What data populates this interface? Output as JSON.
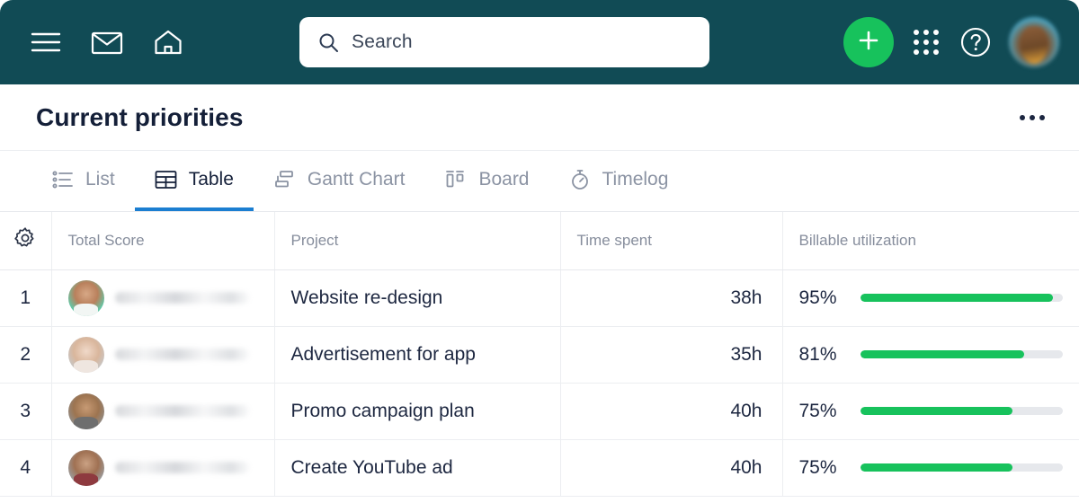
{
  "topbar": {
    "bg_color": "#114b55",
    "icons": [
      {
        "name": "hamburger-menu-icon",
        "label": "Menu"
      },
      {
        "name": "mail-icon",
        "label": "Mail"
      },
      {
        "name": "home-icon",
        "label": "Home"
      }
    ],
    "search": {
      "placeholder": "Search",
      "icon": "search-icon"
    },
    "add_button": {
      "label": "+",
      "color": "#17c25c",
      "icon": "plus-icon"
    },
    "apps_icon": "apps-grid-icon",
    "help_icon": "help-circle-icon",
    "avatar": "user-avatar"
  },
  "header": {
    "title": "Current priorities",
    "menu_icon": "more-options-icon"
  },
  "tabs": [
    {
      "label": "List",
      "icon": "list-icon",
      "active": false
    },
    {
      "label": "Table",
      "icon": "table-icon",
      "active": true
    },
    {
      "label": "Gantt Chart",
      "icon": "gantt-icon",
      "active": false
    },
    {
      "label": "Board",
      "icon": "board-icon",
      "active": false
    },
    {
      "label": "Timelog",
      "icon": "stopwatch-icon",
      "active": false
    }
  ],
  "accent_colors": {
    "tab_underline": "#1b7ed1",
    "progress_fill": "#17c25c",
    "progress_track": "#e6e8ec"
  },
  "table": {
    "settings_icon": "gear-icon",
    "columns": [
      {
        "key": "index",
        "label": ""
      },
      {
        "key": "score",
        "label": "Total Score"
      },
      {
        "key": "project",
        "label": "Project"
      },
      {
        "key": "time",
        "label": "Time spent"
      },
      {
        "key": "bill",
        "label": "Billable utilization"
      }
    ],
    "rows": [
      {
        "index": "1",
        "assignee": "",
        "project": "Website re-design",
        "time_spent": "38h",
        "utilization_label": "95%",
        "utilization_value": 95
      },
      {
        "index": "2",
        "assignee": "",
        "project": "Advertisement for app",
        "time_spent": "35h",
        "utilization_label": "81%",
        "utilization_value": 81
      },
      {
        "index": "3",
        "assignee": "",
        "project": "Promo campaign plan",
        "time_spent": "40h",
        "utilization_label": "75%",
        "utilization_value": 75
      },
      {
        "index": "4",
        "assignee": "",
        "project": "Create YouTube ad",
        "time_spent": "40h",
        "utilization_label": "75%",
        "utilization_value": 75
      }
    ]
  }
}
